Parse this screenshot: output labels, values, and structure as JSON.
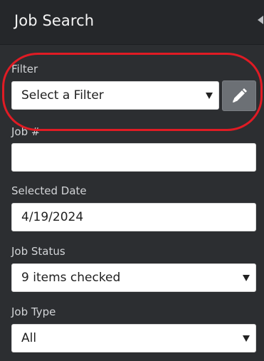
{
  "header": {
    "title": "Job Search"
  },
  "filter": {
    "label": "Filter",
    "selected": "Select a Filter",
    "edit_icon": "pencil-icon"
  },
  "job_number": {
    "label": "Job #",
    "value": ""
  },
  "selected_date": {
    "label": "Selected Date",
    "value": "4/19/2024"
  },
  "job_status": {
    "label": "Job Status",
    "selected": "9 items checked"
  },
  "job_type": {
    "label": "Job Type",
    "selected": "All"
  },
  "colors": {
    "panel_bg": "#2c2e31",
    "header_bg": "#25272a",
    "highlight": "#e01b24",
    "edit_button": "#6c7075"
  }
}
